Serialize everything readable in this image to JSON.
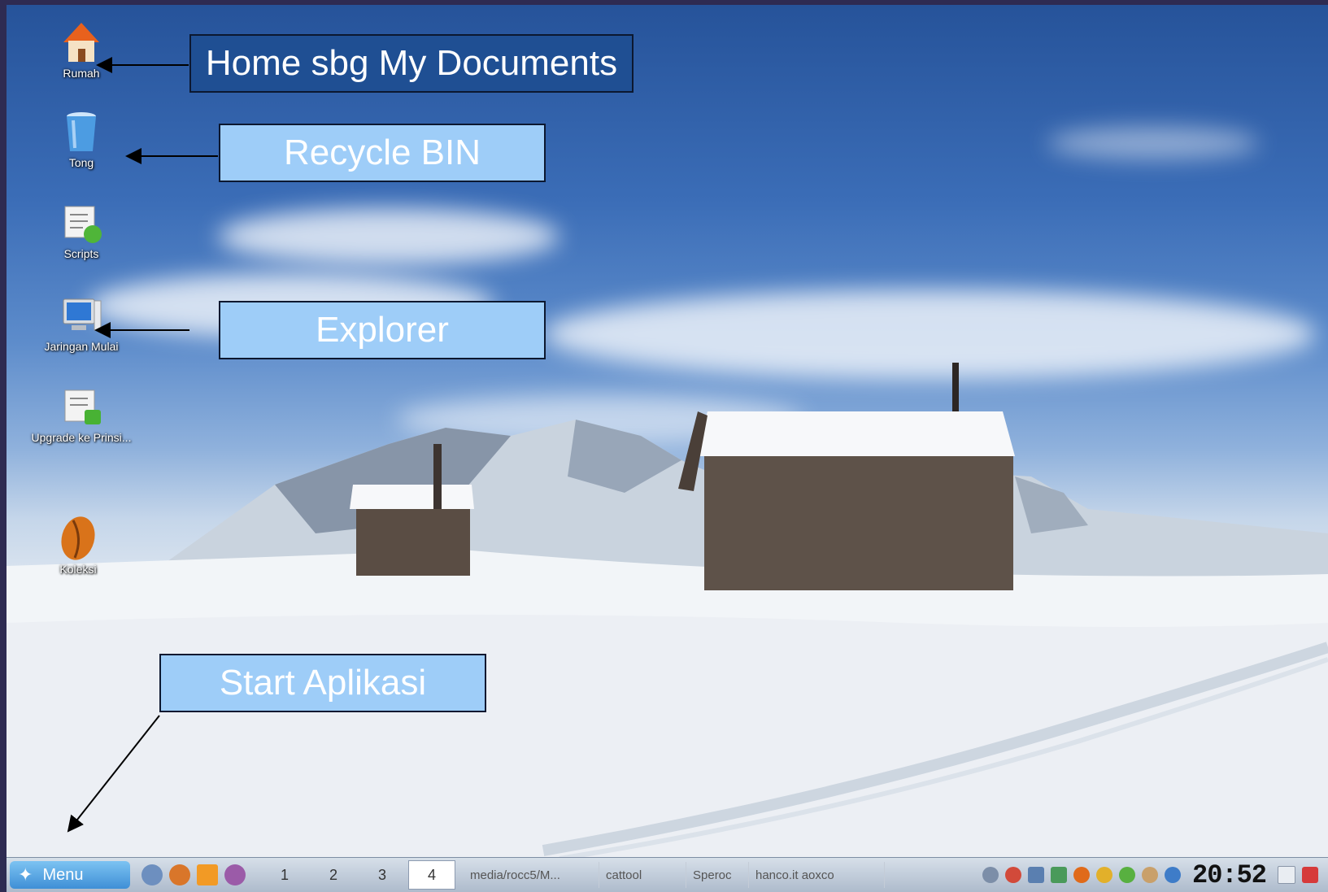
{
  "desktop": {
    "icons": [
      {
        "label": "Rumah"
      },
      {
        "label": "Tong"
      },
      {
        "label": "Scripts"
      },
      {
        "label": "Jaringan Mulai"
      },
      {
        "label": "Upgrade ke Prinsi..."
      },
      {
        "label": "Koleksi"
      }
    ]
  },
  "callouts": {
    "home": "Home sbg My Documents",
    "recycle": "Recycle BIN",
    "explorer": "Explorer",
    "start": "Start Aplikasi"
  },
  "taskbar": {
    "menu_label": "Menu",
    "workspaces": [
      "1",
      "2",
      "3",
      "4"
    ],
    "active_workspace": "4",
    "tasks": [
      "media/rocc5/M...",
      "cattool",
      "Speroc",
      "hanco.it aoxco"
    ],
    "clock": "20:52"
  },
  "colors": {
    "callout_blue": "#9ecdf8",
    "callout_dark": "#1f4f93",
    "menu_button": "#3f8fd6"
  }
}
